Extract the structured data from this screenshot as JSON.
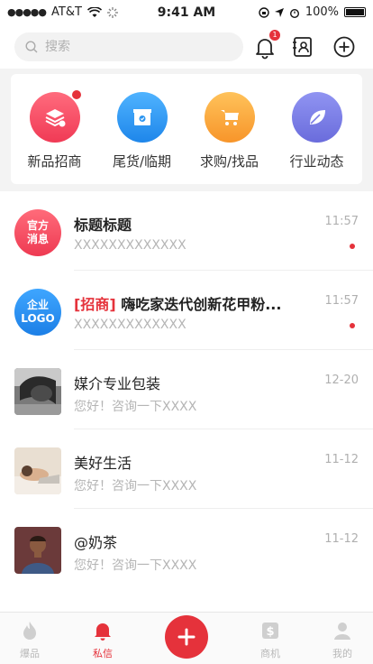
{
  "status_bar": {
    "carrier": "AT&T",
    "time": "9:41 AM",
    "battery": "100%"
  },
  "header": {
    "search_placeholder": "搜索",
    "notification_count": "1"
  },
  "categories": [
    {
      "label": "新品招商",
      "icon": "layers-icon",
      "color": "#f24a62",
      "has_dot": true
    },
    {
      "label": "尾货/临期",
      "icon": "box-icon",
      "color": "#2a94f0",
      "has_dot": false
    },
    {
      "label": "求购/找品",
      "icon": "cart-icon",
      "color": "#f8a23a",
      "has_dot": false
    },
    {
      "label": "行业动态",
      "icon": "leaf-icon",
      "color": "#7a7ce6",
      "has_dot": false
    }
  ],
  "messages": [
    {
      "avatar_text": [
        "官方",
        "消息"
      ],
      "avatar_color": "#f0475f",
      "tag": "",
      "title": "标题标题",
      "subtitle": "XXXXXXXXXXXXX",
      "time": "11:57",
      "unread": true
    },
    {
      "avatar_text": [
        "企业",
        "LOGO"
      ],
      "avatar_color": "#2a8ff0",
      "tag": "[招商]",
      "title": "嗨吃家迭代创新花甲粉...",
      "subtitle": "XXXXXXXXXXXXX",
      "time": "11:57",
      "unread": true
    },
    {
      "avatar_text": [],
      "tag": "",
      "title": "媒介专业包装",
      "subtitle": "您好！咨询一下XXXX",
      "time": "12-20",
      "unread": false
    },
    {
      "avatar_text": [],
      "tag": "",
      "title": "美好生活",
      "subtitle": "您好！咨询一下XXXX",
      "time": "11-12",
      "unread": false
    },
    {
      "avatar_text": [],
      "tag": "",
      "title": "@奶茶",
      "subtitle": "您好！咨询一下XXXX",
      "time": "11-12",
      "unread": false
    }
  ],
  "tabbar": {
    "tabs": [
      {
        "label": "爆品",
        "icon": "flame-icon",
        "active": false
      },
      {
        "label": "私信",
        "icon": "bell-icon",
        "active": true
      },
      {
        "label": "商机",
        "icon": "dollar-icon",
        "active": false
      },
      {
        "label": "我的",
        "icon": "person-icon",
        "active": false
      }
    ]
  },
  "colors": {
    "accent": "#e5323b"
  }
}
